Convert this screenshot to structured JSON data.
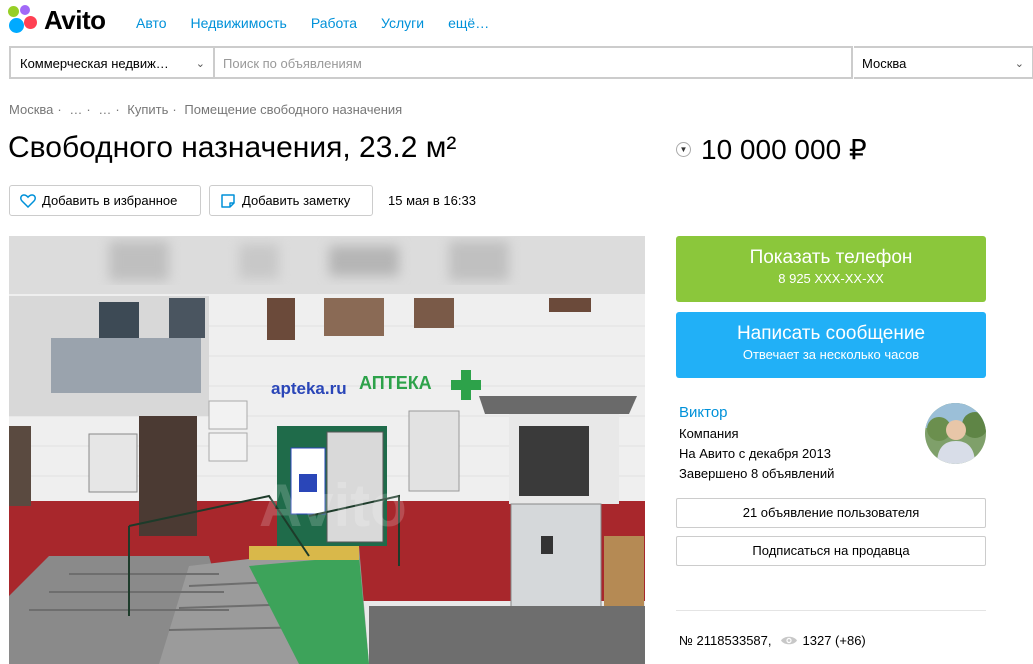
{
  "header": {
    "logo_text": "Avito",
    "nav": [
      "Авто",
      "Недвижимость",
      "Работа",
      "Услуги",
      "ещё…"
    ]
  },
  "search": {
    "category": "Коммерческая недвиж…",
    "placeholder": "Поиск по объявлениям",
    "city": "Москва"
  },
  "breadcrumb": [
    "Москва",
    "…",
    "…",
    "Купить",
    "Помещение свободного назначения"
  ],
  "listing": {
    "title": "Свободного назначения, 23.2 м²",
    "price": "10 000 000 ₽",
    "favorite_label": "Добавить в избранное",
    "note_label": "Добавить заметку",
    "date": "15 мая в 16:33",
    "id_text": "№ 2118533587,",
    "views": "1327 (+86)"
  },
  "photo": {
    "sign_left": "apteka.ru",
    "sign_right": "АПТЕКА",
    "watermark": "Avito"
  },
  "contact": {
    "phone_label": "Показать телефон",
    "phone_masked": "8 925 XXX-XX-XX",
    "message_label": "Написать сообщение",
    "message_sub": "Отвечает за несколько часов"
  },
  "seller": {
    "name": "Виктор",
    "type": "Компания",
    "since": "На Авито с декабря 2013",
    "completed": "Завершено 8 объявлений",
    "ads_button": "21 объявление пользователя",
    "subscribe_button": "Подписаться на продавца"
  },
  "colors": {
    "link": "#0091d9",
    "phone_button": "#8bc73b",
    "message_button": "#21b0f7"
  }
}
